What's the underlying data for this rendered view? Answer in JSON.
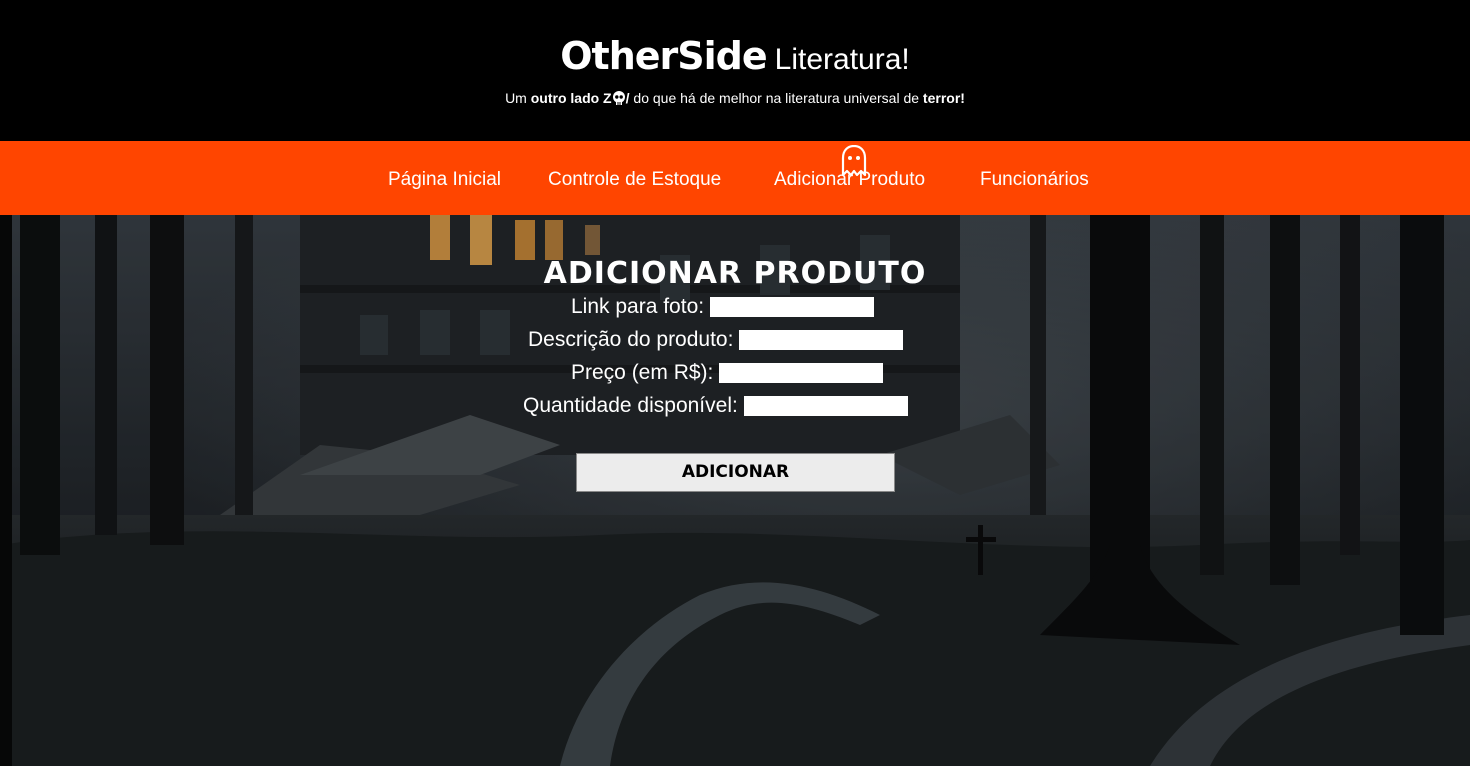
{
  "header": {
    "brand_name": "OtherSide",
    "brand_sub": "Literatura!",
    "tagline_prefix": "Um ",
    "tagline_bold1": "outro lado Z",
    "tagline_bold2": "/",
    "tagline_mid": " do que há de melhor na literatura universal de ",
    "tagline_bold3": "terror!"
  },
  "nav": {
    "items": [
      {
        "label": "Página Inicial"
      },
      {
        "label": "Controle de Estoque"
      },
      {
        "label": "Adicionar Produto"
      },
      {
        "label": "Funcionários"
      }
    ]
  },
  "form": {
    "title": "ADICIONAR PRODUTO",
    "fields": [
      {
        "label": "Link para foto:",
        "value": ""
      },
      {
        "label": "Descrição do produto:",
        "value": ""
      },
      {
        "label": "Preço (em R$):",
        "value": ""
      },
      {
        "label": "Quantidade disponível:",
        "value": ""
      }
    ],
    "submit_label": "ADICIONAR"
  },
  "colors": {
    "nav_bg": "#ff4500",
    "header_bg": "#000000"
  }
}
